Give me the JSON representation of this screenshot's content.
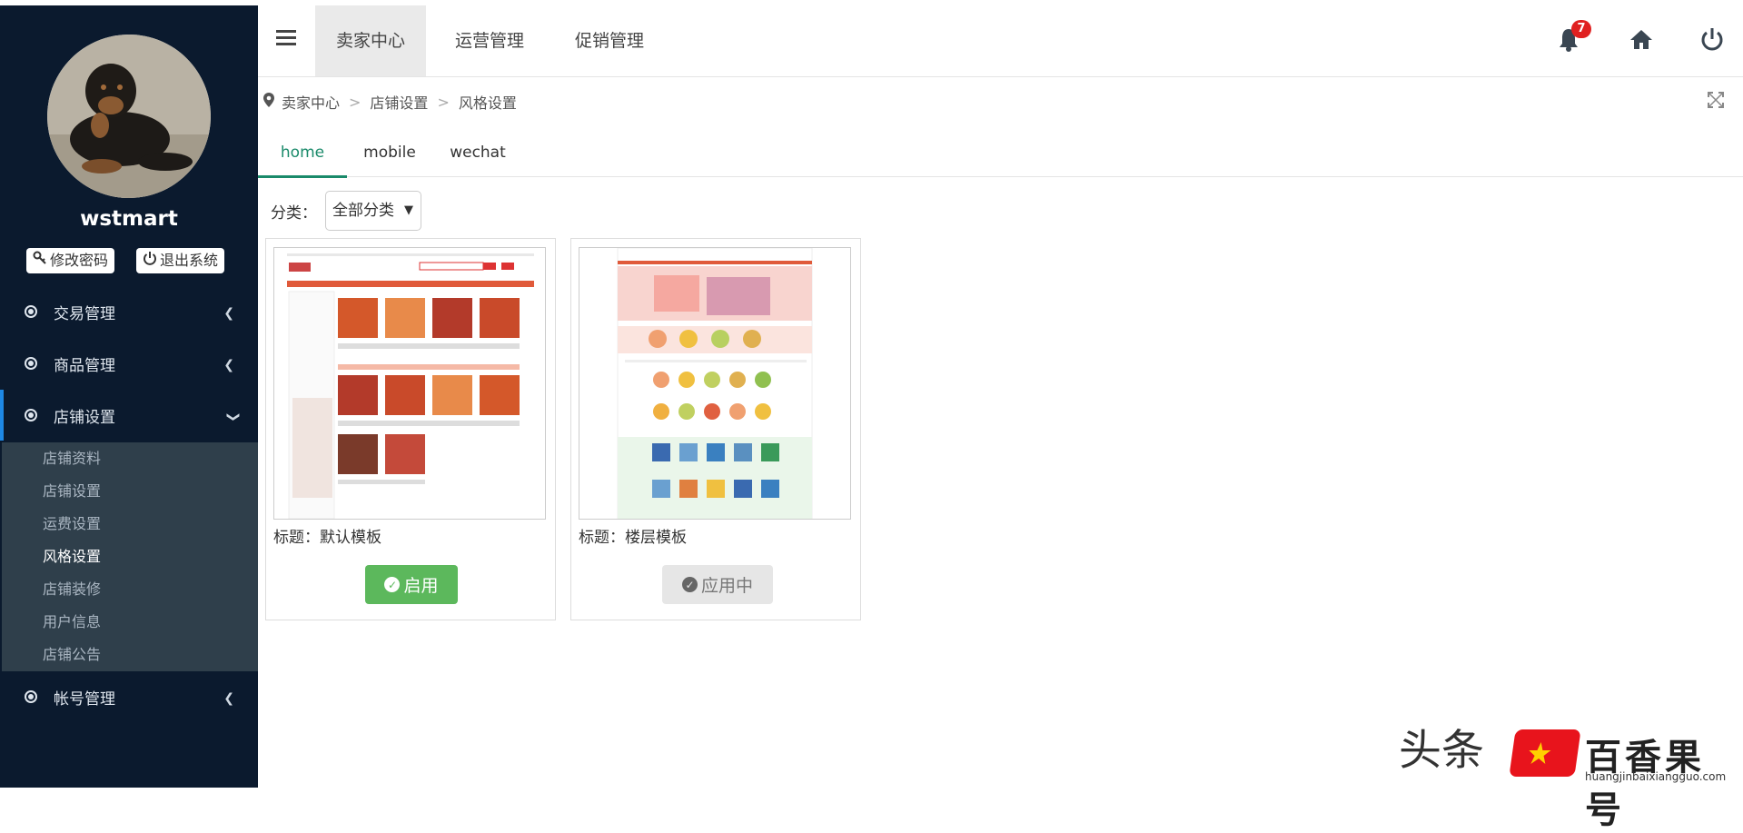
{
  "sidebar": {
    "username": "wstmart",
    "change_password_label": "修改密码",
    "logout_label": "退出系统",
    "menu": [
      {
        "label": "交易管理"
      },
      {
        "label": "商品管理"
      },
      {
        "label": "店铺设置"
      },
      {
        "label": "帐号管理"
      }
    ],
    "submenu": [
      "店铺资料",
      "店铺设置",
      "运费设置",
      "风格设置",
      "店铺装修",
      "用户信息",
      "店铺公告"
    ],
    "current_submenu": "风格设置"
  },
  "topbar": {
    "tabs": [
      "卖家中心",
      "运营管理",
      "促销管理"
    ],
    "active_tab": "卖家中心",
    "notification_count": "7"
  },
  "breadcrumb": [
    "卖家中心",
    "店铺设置",
    "风格设置"
  ],
  "content": {
    "tabs": [
      "home",
      "mobile",
      "wechat"
    ],
    "active_tab": "home",
    "filter_label": "分类：",
    "filter_value": "全部分类",
    "templates": [
      {
        "title": "标题：默认模板",
        "button": "启用",
        "state": "enable"
      },
      {
        "title": "标题：楼层模板",
        "button": "应用中",
        "state": "applied"
      }
    ]
  },
  "watermark": {
    "source": "头条",
    "name": "百香果号",
    "url": "huangjinbaixiangguo.com"
  },
  "colors": {
    "sidebar_bg": "#0b1a2e",
    "submenu_bg": "#2f3f4b",
    "active_tab": "#1a8a6a",
    "enable_button": "#5cb85c",
    "badge": "#e02020"
  }
}
